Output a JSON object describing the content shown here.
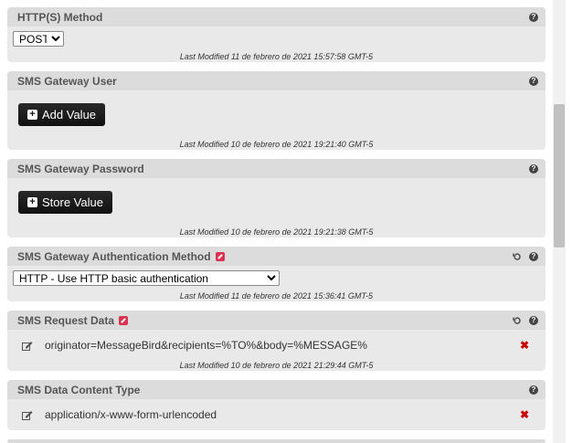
{
  "icons": {
    "help": "question-circle-icon",
    "revert": "revert-icon",
    "edit": "pencil-square-icon",
    "delete": "x-icon",
    "add": "plus-square-icon"
  },
  "colors": {
    "panel_bg": "#e9e9e9",
    "header_bg": "#dcdcdc",
    "accent_red": "#d9334f",
    "delete_red": "#cc0000",
    "button_bg": "#1a1a1a"
  },
  "panels": {
    "method": {
      "title": "HTTP(S) Method",
      "select_value": "POST",
      "last_modified": "Last Modified 11 de febrero de 2021 15:57:58 GMT-5"
    },
    "user": {
      "title": "SMS Gateway User",
      "button_label": "Add Value",
      "last_modified": "Last Modified 10 de febrero de 2021 19:21:40 GMT-5"
    },
    "password": {
      "title": "SMS Gateway Password",
      "button_label": "Store Value",
      "last_modified": "Last Modified 10 de febrero de 2021 19:21:38 GMT-5"
    },
    "auth": {
      "title": "SMS Gateway Authentication Method",
      "select_value": "HTTP - Use HTTP basic authentication",
      "last_modified": "Last Modified 11 de febrero de 2021 15:36:41 GMT-5"
    },
    "request": {
      "title": "SMS Request Data",
      "value": "originator=MessageBird&recipients=%TO%&body=%MESSAGE%",
      "last_modified": "Last Modified 10 de febrero de 2021 21:29:44 GMT-5"
    },
    "content_type": {
      "title": "SMS Data Content Type",
      "value": "application/x-www-form-urlencoded"
    }
  }
}
